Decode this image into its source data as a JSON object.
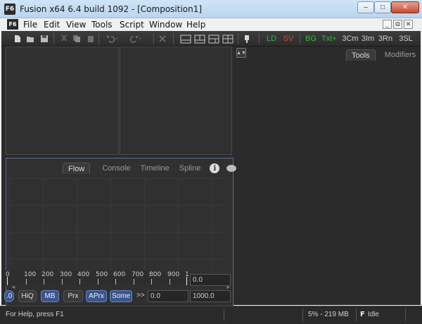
{
  "window": {
    "title": "Fusion x64 6.4 build 1092 - [Composition1]",
    "app_icon_label": "F6",
    "min_glyph": "–",
    "max_glyph": "□",
    "close_glyph": "✕"
  },
  "menu": {
    "items": [
      "File",
      "Edit",
      "View",
      "Tools",
      "Script",
      "Window",
      "Help"
    ],
    "mdi_min": "_",
    "mdi_restore": "⧉",
    "mdi_close": "✕"
  },
  "toolbar": {
    "tool_buttons": [
      "LD",
      "SV",
      "BG",
      "Txt+",
      "3Cm",
      "3Im",
      "3Rn",
      "3SL"
    ],
    "colors": {
      "LD": "#3cb43c",
      "SV": "#d24a3a",
      "BG": "#3cb43c",
      "Txt+": "#3cb43c"
    }
  },
  "flow_panel": {
    "tabs": [
      "Flow",
      "Console",
      "Timeline",
      "Spline"
    ],
    "active_tab": "Flow"
  },
  "right_panel": {
    "tabs": [
      "Tools",
      "Modifiers"
    ],
    "active_tab": "Tools"
  },
  "timeline": {
    "ticks": [
      "0",
      "100",
      "200",
      "300",
      "400",
      "500",
      "600",
      "700",
      "800",
      "900",
      "1"
    ],
    "current_time": "0.0",
    "render_start": ".0",
    "render_range_start": "0.0",
    "render_range_end": "1000.0",
    "step_arrows": ">>"
  },
  "controls": {
    "hiq": "HiQ",
    "mb": "MB",
    "prx": "Prx",
    "aprx": "APrx",
    "some": "Some"
  },
  "status": {
    "help_text": "For Help, press F1",
    "usage": "5% - 219 MB",
    "state_icon": "F",
    "state": "Idle"
  }
}
